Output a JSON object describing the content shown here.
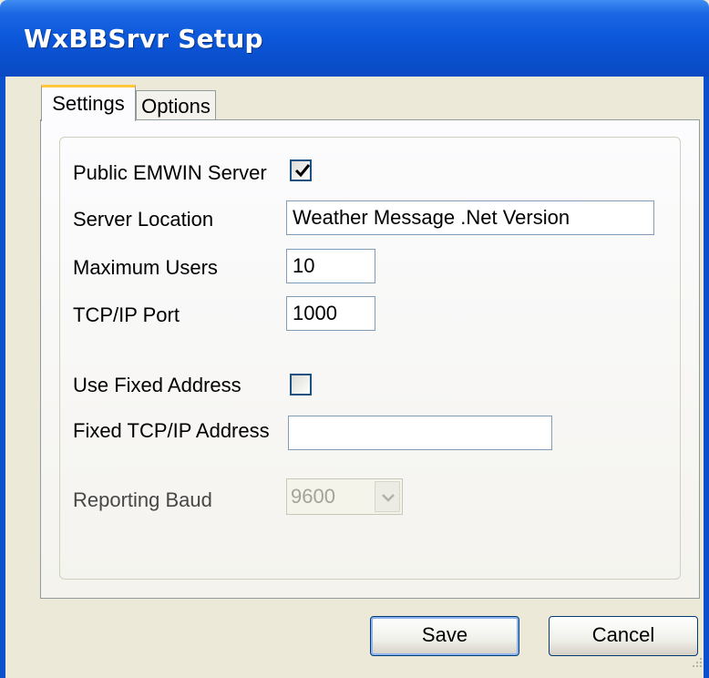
{
  "window": {
    "title": "WxBBSrvr Setup"
  },
  "tabs": [
    {
      "label": "Settings"
    },
    {
      "label": "Options"
    }
  ],
  "settings": {
    "public_emwin_label": "Public EMWIN Server",
    "public_emwin_checked": true,
    "server_location_label": "Server Location",
    "server_location_value": "Weather Message .Net Version",
    "max_users_label": "Maximum Users",
    "max_users_value": "10",
    "tcp_port_label": "TCP/IP Port",
    "tcp_port_value": "1000",
    "use_fixed_label": "Use Fixed Address",
    "use_fixed_checked": false,
    "fixed_address_label": "Fixed TCP/IP Address",
    "fixed_address_value": "",
    "reporting_baud_label": "Reporting Baud",
    "reporting_baud_value": "9600"
  },
  "buttons": {
    "save": "Save",
    "cancel": "Cancel"
  },
  "icons": {
    "check": "checkmark-icon",
    "dropdown": "chevron-down-icon",
    "grip": "resize-grip-icon"
  },
  "colors": {
    "titlebar": "#0a4fcc",
    "dialog_bg": "#ece9d8",
    "tab_highlight": "#ffc83c",
    "check": "#21a121"
  }
}
